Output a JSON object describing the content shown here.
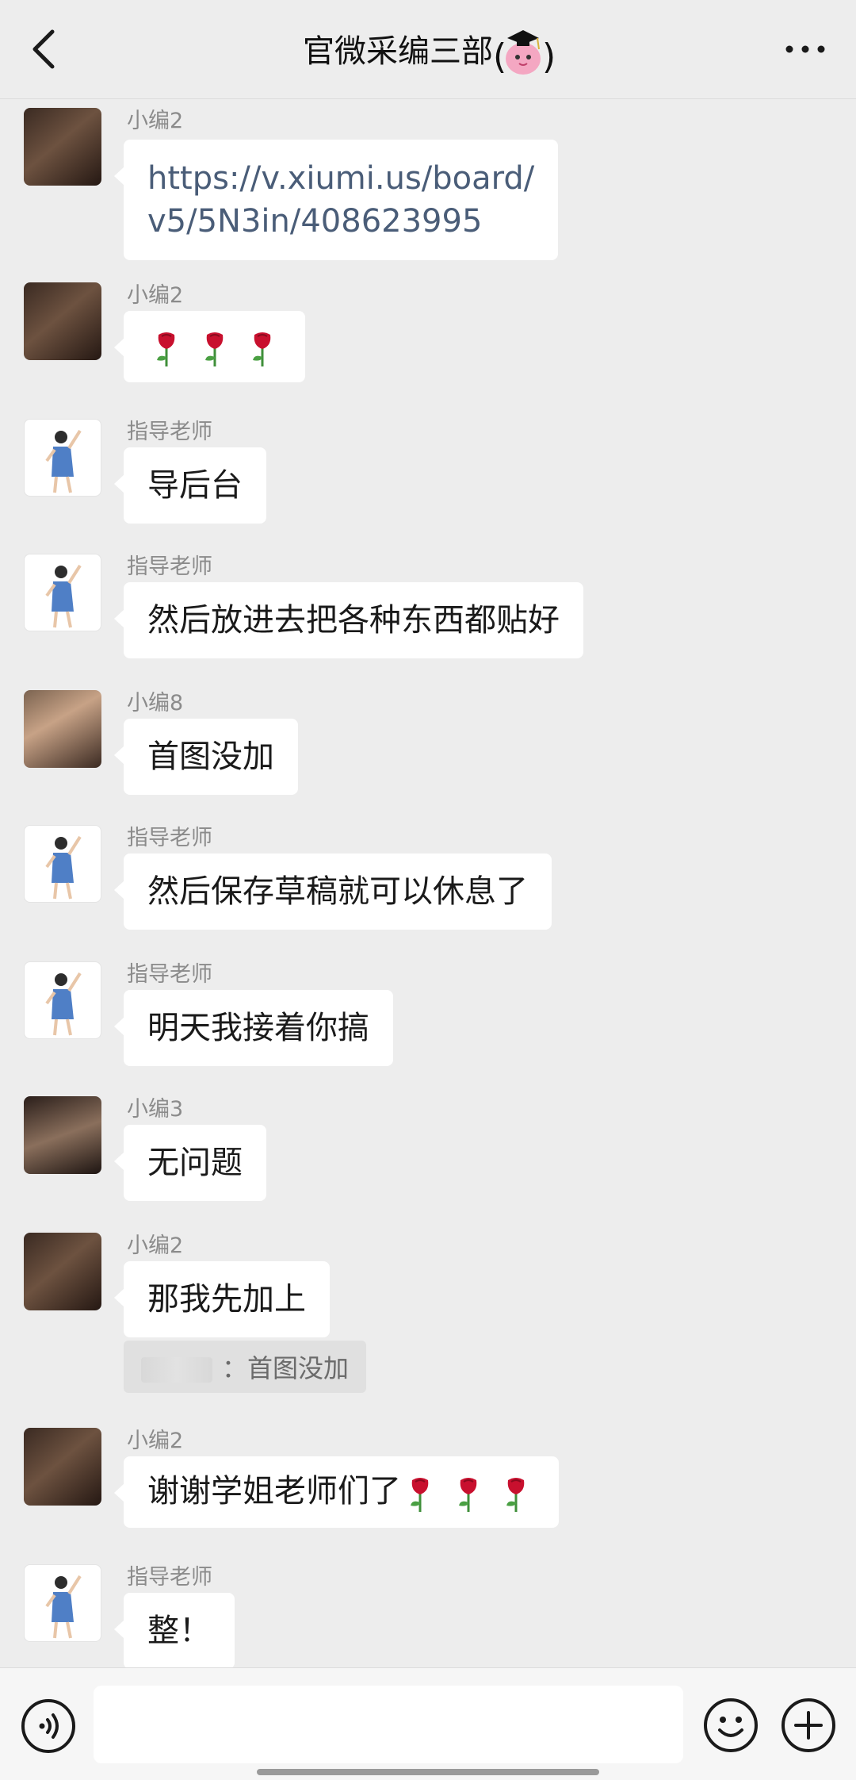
{
  "header": {
    "title": "官微采编三部",
    "back_icon": "chevron-left-icon",
    "more_icon": "more-dots-icon"
  },
  "messages": [
    {
      "sender": "小编2",
      "avatar": "dark",
      "text_lines": [
        "https://v.xiumi.us/board/",
        "v5/5N3in/408623995"
      ],
      "type": "link"
    },
    {
      "sender": "小编2",
      "avatar": "dark",
      "emojis": [
        "rose",
        "rose",
        "rose"
      ],
      "type": "emoji"
    },
    {
      "sender": "指导老师",
      "avatar": "teacher",
      "text": "导后台"
    },
    {
      "sender": "指导老师",
      "avatar": "teacher",
      "text": "然后放进去把各种东西都贴好"
    },
    {
      "sender": "小编8",
      "avatar": "girl",
      "text": "首图没加"
    },
    {
      "sender": "指导老师",
      "avatar": "teacher",
      "text": "然后保存草稿就可以休息了"
    },
    {
      "sender": "指导老师",
      "avatar": "teacher",
      "text": "明天我接着你搞"
    },
    {
      "sender": "小编3",
      "avatar": "dog",
      "text": "无问题"
    },
    {
      "sender": "小编2",
      "avatar": "dark",
      "text": "那我先加上",
      "quote": {
        "separator": "：",
        "text": "首图没加"
      }
    },
    {
      "sender": "小编2",
      "avatar": "dark",
      "text": "谢谢学姐老师们了",
      "trailing_emojis": [
        "rose",
        "rose",
        "rose"
      ]
    },
    {
      "sender": "指导老师",
      "avatar": "teacher",
      "text": "整！"
    }
  ],
  "inputbar": {
    "voice_icon": "voice-icon",
    "emoji_icon": "emoji-smile-icon",
    "plus_icon": "plus-circle-icon",
    "placeholder": ""
  },
  "colors": {
    "background": "#ededed",
    "bubble": "#ffffff",
    "link_text": "#4a5d78",
    "sender_text": "#8b8b8b"
  }
}
